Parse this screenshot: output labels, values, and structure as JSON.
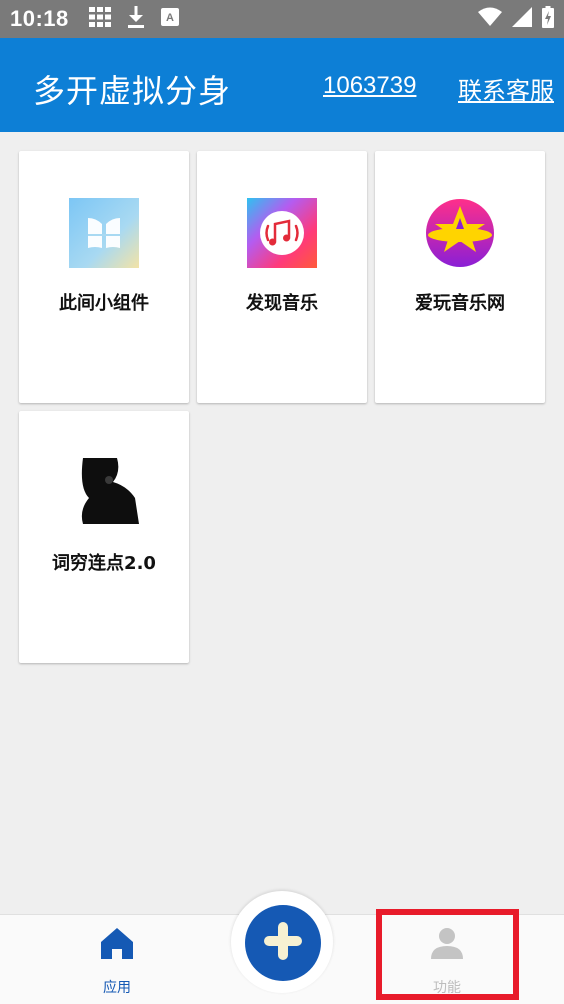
{
  "status_bar": {
    "time": "10:18",
    "icons": [
      "grid-icon",
      "download-icon",
      "font-icon",
      "wifi-icon",
      "signal-icon",
      "battery-icon"
    ]
  },
  "header": {
    "title": "多开虚拟分身",
    "user_id": "1063739",
    "contact_label": "联系客服",
    "background_color": "#0d7fd6"
  },
  "apps": [
    {
      "name": "此间小组件",
      "icon": "widget-app-icon"
    },
    {
      "name": "发现音乐",
      "icon": "music-note-app-icon"
    },
    {
      "name": "爱玩音乐网",
      "icon": "star-planet-app-icon"
    },
    {
      "name": "词穷连点2.0",
      "icon": "silhouette-photo-app-icon"
    }
  ],
  "bottom_nav": {
    "items": [
      {
        "label": "应用",
        "icon": "home-icon",
        "active": true
      },
      {
        "label": "功能",
        "icon": "person-icon",
        "active": false
      }
    ],
    "fab_icon": "plus-icon",
    "active_color": "#1559b4",
    "inactive_color": "#bdbdbd"
  },
  "annotation": {
    "highlight_color": "#e81b2a"
  }
}
